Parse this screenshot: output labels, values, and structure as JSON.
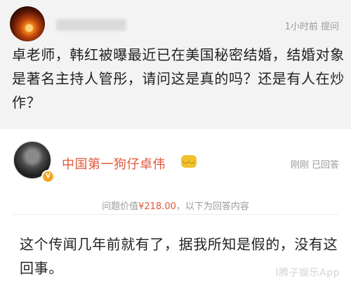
{
  "question": {
    "meta": "1小时前 提问",
    "text": "卓老师，韩红被曝最近已在美国秘密结婚，结婚对象是著名主持人管彤，请问这是真的吗？还是有人在炒作？"
  },
  "answer": {
    "author": "中国第一狗仔卓伟",
    "author_emoji": "emoji-face-icon",
    "meta": "刚刚 已回答",
    "price_prefix": "问题价值",
    "price": "¥218.00",
    "price_suffix": "，以下为回答内容",
    "text": "这个传闻几年前就有了，据我所知是假的，没有这回事。"
  },
  "watermark": "I腾子娱乐App",
  "colors": {
    "accent": "#e2573a",
    "meta_gray": "#9a9a9a",
    "question_bg": "#f3f3f3"
  }
}
